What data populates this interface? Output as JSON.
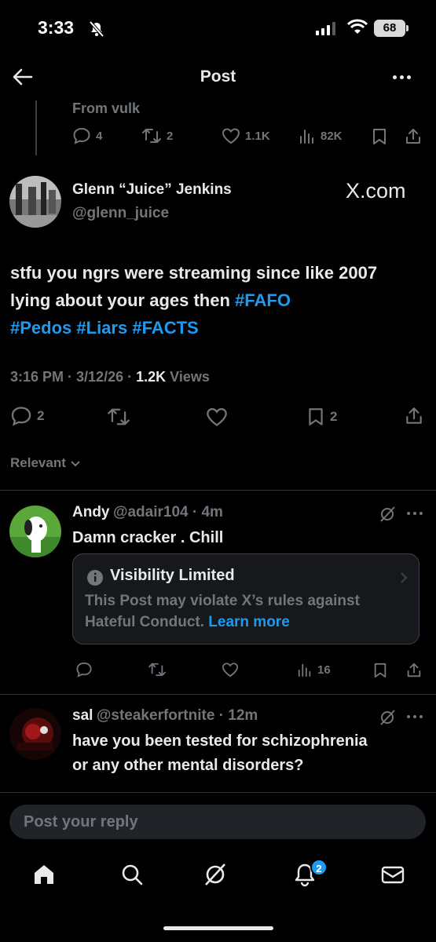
{
  "status": {
    "time": "3:33",
    "battery": "68"
  },
  "header": {
    "title": "Post"
  },
  "quoted_context": {
    "from": "From vulk",
    "replies": "4",
    "reposts": "2",
    "likes": "1.1K",
    "views": "82K"
  },
  "post": {
    "author_name": "Glenn “Juice” Jenkins",
    "author_handle": "@glenn_juice",
    "source_label": "X.com",
    "text": "stfu you ngrs were streaming since like 2007 lying about your ages then ",
    "hashtags": [
      "#FAFO",
      "#Pedos",
      "#Liars",
      "#FACTS"
    ],
    "time": "3:16 PM",
    "date": "3/12/26",
    "views_count": "1.2K",
    "views_label": "Views",
    "replies": "2",
    "bookmarks": "2"
  },
  "sort": {
    "label": "Relevant"
  },
  "replies": [
    {
      "name": "Andy",
      "handle": "@adair104",
      "age": "4m",
      "text": "Damn cracker . Chill",
      "notice": {
        "title": "Visibility Limited",
        "body": "This Post may violate X’s rules against Hateful Conduct.",
        "link": "Learn more"
      },
      "views": "16"
    },
    {
      "name": "sal",
      "handle": "@steakerfortnite",
      "age": "12m",
      "text_line1": "have you been tested for schizophrenia",
      "text_line2": "or any other mental disorders?"
    }
  ],
  "composer": {
    "placeholder": "Post your reply"
  },
  "tabbar": {
    "notifications_badge": "2"
  },
  "colors": {
    "accent": "#1d9bf0",
    "background": "#000000",
    "muted": "#71767b"
  }
}
